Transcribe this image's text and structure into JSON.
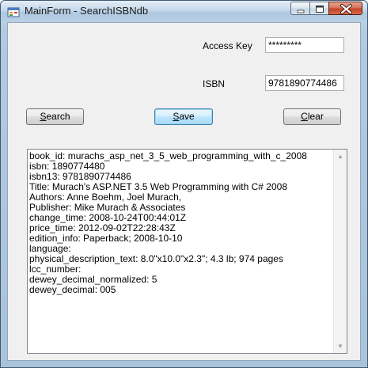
{
  "window": {
    "title": "MainForm - SearchISBNdb"
  },
  "form": {
    "access_key_label": "Access Key",
    "access_key_value": "*********",
    "isbn_label": "ISBN",
    "isbn_value": "9781890774486"
  },
  "buttons": {
    "search": {
      "mnemonic": "S",
      "rest": "earch"
    },
    "save": {
      "mnemonic": "S",
      "rest": "ave"
    },
    "clear": {
      "mnemonic": "C",
      "rest": "lear"
    }
  },
  "results": {
    "lines": [
      "book_id: murachs_asp_net_3_5_web_programming_with_c_2008",
      "isbn: 1890774480",
      "isbn13: 9781890774486",
      "Title: Murach's ASP.NET 3.5 Web Programming with C# 2008",
      "Authors: Anne Boehm, Joel Murach,",
      "Publisher: Mike Murach & Associates",
      "change_time: 2008-10-24T00:44:01Z",
      "price_time: 2012-09-02T22:28:43Z",
      "edition_info: Paperback; 2008-10-10",
      "language:",
      "physical_description_text: 8.0\"x10.0\"x2.3\"; 4.3 lb; 974 pages",
      "lcc_number:",
      "dewey_decimal_normalized: 5",
      "dewey_decimal: 005"
    ]
  },
  "icons": {
    "app": "form-icon",
    "minimize": "minimize-icon",
    "maximize": "maximize-icon",
    "close": "close-icon",
    "scroll_up": "scroll-up-arrow-icon",
    "scroll_down": "scroll-down-arrow-icon"
  },
  "colors": {
    "titlebar": "#b9d0e5",
    "client_background": "#f0f0f0",
    "close_button": "#c2432a",
    "default_button_border": "#3c7fb1"
  }
}
